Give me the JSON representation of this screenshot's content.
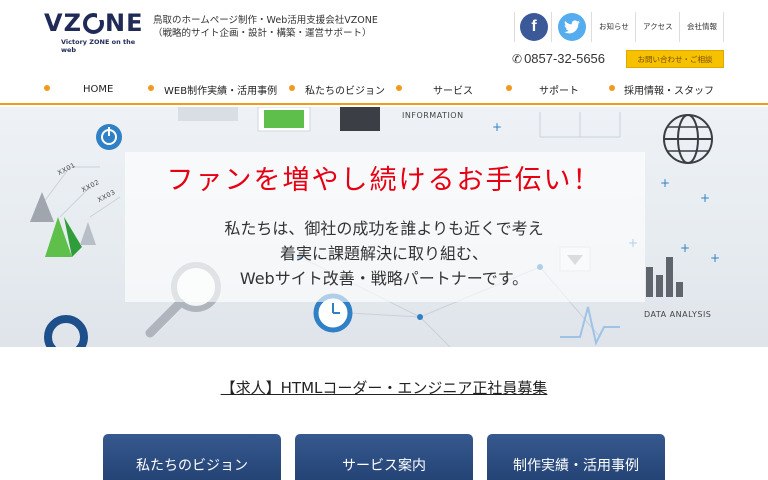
{
  "header": {
    "logo_text": "VZONE",
    "logo_sub": "Victory ZONE on the web",
    "tagline_1": "鳥取のホームページ制作・Web活用支援会社VZONE",
    "tagline_2": "（戦略的サイト企画・設計・構築・運営サポート）",
    "social": [
      {
        "name": "facebook",
        "glyph": "f"
      },
      {
        "name": "twitter",
        "glyph": "🐦"
      }
    ],
    "top_links": [
      "お知らせ",
      "アクセス",
      "会社情報"
    ],
    "phone": "0857-32-5656",
    "contact_button": "お問い合わせ・ご相談"
  },
  "nav": {
    "items": [
      "HOME",
      "WEB制作実績・活用事例",
      "私たちのビジョン",
      "サービス",
      "サポート",
      "採用情報・スタッフ"
    ]
  },
  "hero": {
    "title": "ファンを増やし続けるお手伝い！",
    "subtitle_lines": [
      "私たちは、御社の成功を誰よりも近くで考え",
      "着実に課題解決に取り組む、",
      "Webサイト改善・戦略パートナーです。"
    ],
    "caption_information": "INFORMATION",
    "caption_data_analysis": "DATA ANALYSIS",
    "labels": [
      "XX01",
      "XX02",
      "XX03"
    ]
  },
  "recruit": {
    "text": "【求人】HTMLコーダー・エンジニア正社員募集"
  },
  "buttons": [
    "私たちのビジョン",
    "サービス案内",
    "制作実績・活用事例"
  ],
  "colors": {
    "accent": "#f39a1c",
    "title_red": "#e60012",
    "navy": "#1f3d6e",
    "contact_yellow": "#f6c200"
  }
}
